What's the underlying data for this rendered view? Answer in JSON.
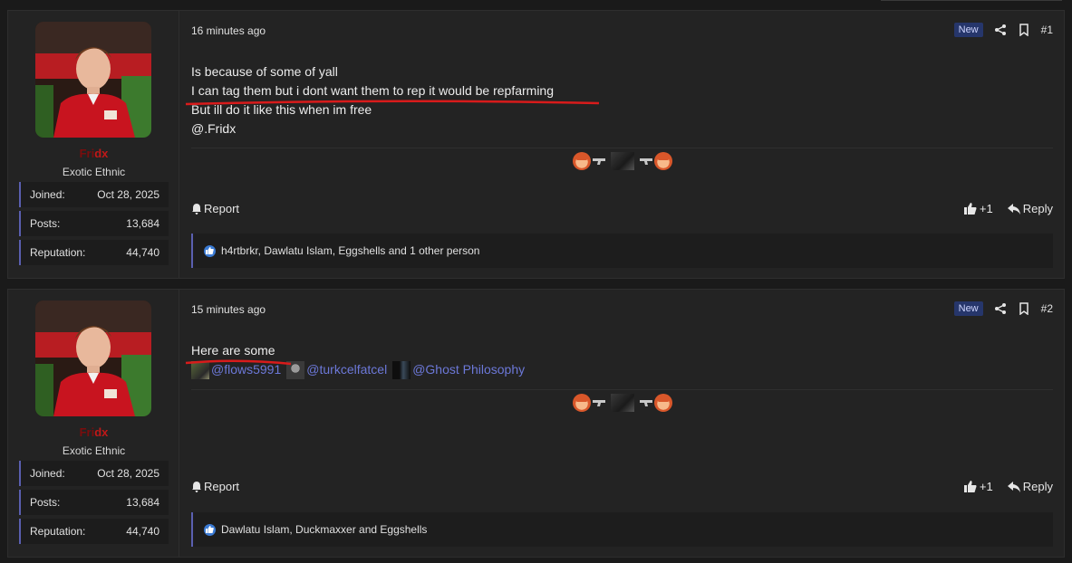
{
  "posts": [
    {
      "user": {
        "name_dim": "Fri",
        "name_hl": "dx",
        "title": "Exotic Ethnic"
      },
      "stats": [
        {
          "label": "Joined:",
          "value": "Oct 28, 2025"
        },
        {
          "label": "Posts:",
          "value": "13,684"
        },
        {
          "label": "Reputation:",
          "value": "44,740"
        }
      ],
      "time": "16 minutes ago",
      "badge": "New",
      "number": "#1",
      "lines": [
        "Is because of some of yall",
        "I can tag them but i dont want them to rep it would be repfarming",
        "But ill do it like this when im free",
        "@.Fridx"
      ],
      "actions": {
        "report": "Report",
        "like_count": "+1",
        "reply": "Reply"
      },
      "reactions": "h4rtbrkr, Dawlatu Islam, Eggshells and 1 other person"
    },
    {
      "user": {
        "name_dim": "Fri",
        "name_hl": "dx",
        "title": "Exotic Ethnic"
      },
      "stats": [
        {
          "label": "Joined:",
          "value": "Oct 28, 2025"
        },
        {
          "label": "Posts:",
          "value": "13,684"
        },
        {
          "label": "Reputation:",
          "value": "44,740"
        }
      ],
      "time": "15 minutes ago",
      "badge": "New",
      "number": "#2",
      "lines": [
        "Here are some"
      ],
      "mentions": [
        "@flows5991",
        "@turkcelfatcel",
        "@Ghost Philosophy"
      ],
      "actions": {
        "report": "Report",
        "like_count": "+1",
        "reply": "Reply"
      },
      "reactions": "Dawlatu Islam, Duckmaxxer and Eggshells"
    }
  ],
  "colors": {
    "accent": "#5a5fb0",
    "username": "#c01818",
    "mention": "#6c78d8",
    "badge_bg": "#26366b"
  }
}
